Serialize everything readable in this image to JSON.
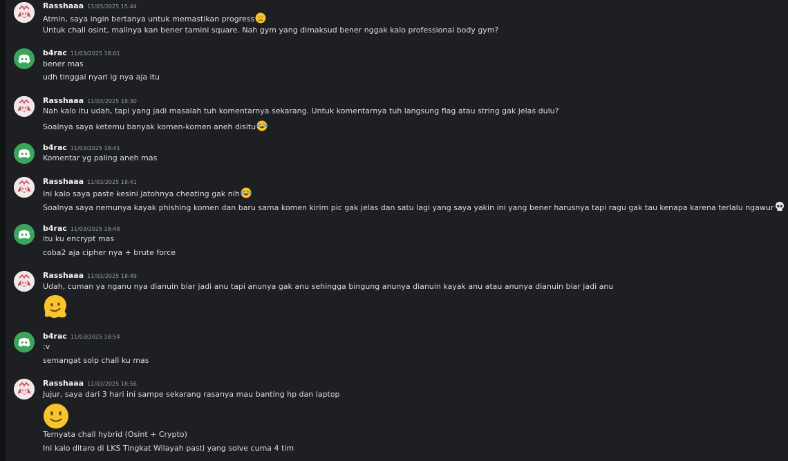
{
  "messages": [
    {
      "user": "Rasshaaa",
      "time": "11/03/2025 15:44",
      "lines": [
        "Atmin, saya ingin bertanya untuk memastikan progress",
        "Untuk chall osint, mallnya kan bener tamini square. Nah gym yang dimaksud bener nggak kalo professional body gym?"
      ]
    },
    {
      "user": "b4rac",
      "time": "11/03/2025 18:01",
      "lines": [
        "bener mas",
        "udh tinggal nyari ig nya aja itu"
      ]
    },
    {
      "user": "Rasshaaa",
      "time": "11/03/2025 18:30",
      "lines": [
        "Nah kalo itu udah, tapi yang jadi masalah tuh komentarnya sekarang. Untuk komentarnya tuh langsung flag atau string gak jelas dulu?",
        "Soalnya saya ketemu banyak komen-komen aneh disitu"
      ]
    },
    {
      "user": "b4rac",
      "time": "11/03/2025 18:41",
      "lines": [
        "Komentar yg paling aneh mas"
      ]
    },
    {
      "user": "Rasshaaa",
      "time": "11/03/2025 18:41",
      "lines": [
        "Ini kalo saya paste kesini jatohnya cheating gak nih",
        "Soalnya saya nemunya kayak phishing komen dan baru sama komen kirim pic gak jelas dan satu lagi yang saya yakin ini yang bener harusnya tapi ragu gak tau kenapa karena terlalu ngawur"
      ]
    },
    {
      "user": "b4rac",
      "time": "11/03/2025 18:48",
      "lines": [
        "itu ku encrypt mas",
        "coba2 aja cipher nya + brute force"
      ]
    },
    {
      "user": "Rasshaaa",
      "time": "11/03/2025 18:49",
      "lines": [
        "Udah, cuman ya nganu nya dianuin biar jadi anu tapi anunya gak anu sehingga bingung anunya dianuin kayak anu atau anunya dianuin biar jadi anu"
      ]
    },
    {
      "user": "b4rac",
      "time": "11/03/2025 18:54",
      "lines": [
        ":v",
        "semangat solp chall ku mas"
      ]
    },
    {
      "user": "Rasshaaa",
      "time": "11/03/2025 18:56",
      "lines": [
        "Jujur, saya dari 3 hari ini sampe sekarang rasanya mau banting hp dan laptop",
        "Ternyata chall hybrid (Osint + Crypto)",
        "Ini kalo ditaro di LKS Tingkat Wilayah pasti yang solve cuma 4 tim"
      ]
    }
  ],
  "icons": {
    "b4rac_avatar": "discord-logo-icon",
    "rasshaaa_avatar": "anime-avatar-icon",
    "emoji_1": "disappointed-emoji-icon",
    "emoji_2": "joy-emoji-icon",
    "emoji_3": "joy-emoji-icon",
    "emoji_4": "skull-emoji-icon",
    "emoji_5": "melting-face-emoji-icon",
    "emoji_6": "slightly-smiling-emoji-icon"
  },
  "colors": {
    "background": "#1e1f22",
    "username": "#f2f3f5",
    "text": "#dbdee1",
    "timestamp": "#949ba4",
    "discord_green": "#3ba55c"
  }
}
